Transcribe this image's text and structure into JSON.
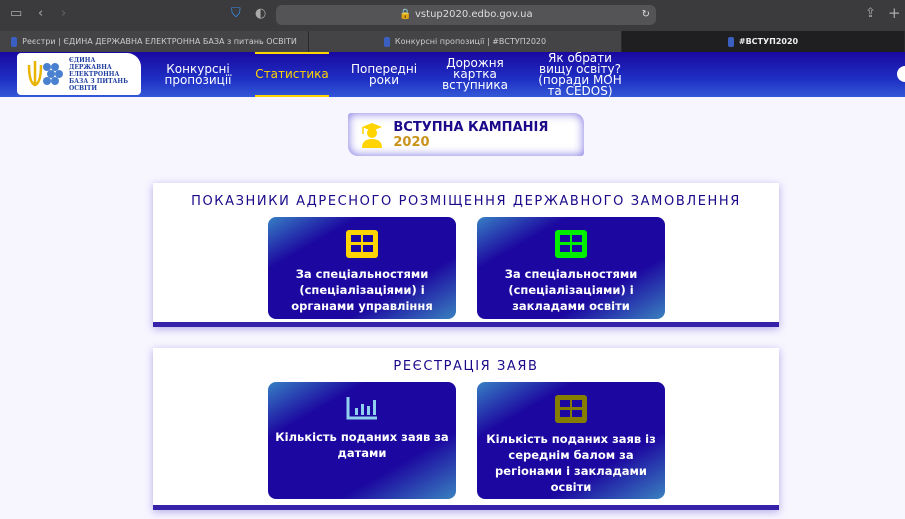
{
  "browser": {
    "url": "vstup2020.edbo.gov.ua",
    "tabs": [
      {
        "label": "Реєстри | ЄДИНА ДЕРЖАВНА ЕЛЕКТРОННА БАЗА з питань ОСВІТИ"
      },
      {
        "label": "Конкурсні пропозиції | #ВСТУП2020"
      },
      {
        "label": "#ВСТУП2020"
      }
    ]
  },
  "logo": {
    "text": "ЄДИНА ДЕРЖАВНА ЕЛЕКТРОННА БАЗА З ПИТАНЬ ОСВІТИ"
  },
  "nav": {
    "items": [
      {
        "label": "Конкурсні пропозиції"
      },
      {
        "label": "Статистика",
        "active": true
      },
      {
        "label": "Попередні роки"
      },
      {
        "label": "Дорожня картка вступника"
      },
      {
        "label": "Як обрати вищу освіту? (поради МОН та CEDOS)"
      }
    ]
  },
  "campaign": {
    "title": "ВСТУПНА КАМПАНІЯ",
    "year": "2020"
  },
  "sections": [
    {
      "title": "ПОКАЗНИКИ АДРЕСНОГО РОЗМІЩЕННЯ ДЕРЖАВНОГО ЗАМОВЛЕННЯ",
      "cards": [
        {
          "label": "За спеціальностями (спеціалізаціями) і органами управління",
          "icon": "table-icon",
          "icon_color": "#ffd400"
        },
        {
          "label": "За спеціальностями (спеціалізаціями) і закладами освіти",
          "icon": "table-icon",
          "icon_color": "#00ee00"
        }
      ]
    },
    {
      "title": "РЕЄСТРАЦІЯ ЗАЯВ",
      "cards": [
        {
          "label": "Кількість поданих заяв за датами",
          "icon": "bar-chart-icon",
          "icon_color": "#8fd0ee"
        },
        {
          "label": "Кількість поданих заяв із середнім балом за регіонами і закладами освіти",
          "icon": "table-icon",
          "icon_color": "#857d00"
        }
      ]
    }
  ]
}
